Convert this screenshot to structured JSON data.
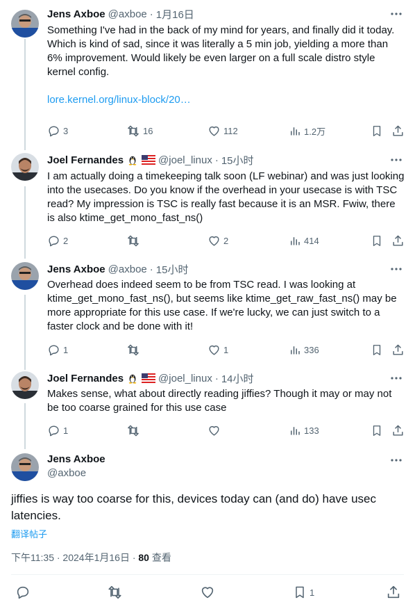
{
  "colors": {
    "accent": "#1d9bf0",
    "muted": "#536471",
    "text": "#0f1419",
    "thread_line": "#cfd9de"
  },
  "tweets": [
    {
      "name": "Jens Axboe",
      "handle": "@axboe",
      "time": "1月16日",
      "text": "Something I've had in the back of my mind for years, and finally did it today. Which is kind of sad, since it was literally a 5 min job, yielding a more than 6% improvement. Would likely be even larger on a full scale distro style kernel config.",
      "link": "lore.kernel.org/linux-block/20…",
      "replies": "3",
      "reposts": "16",
      "likes": "112",
      "views": "1.2万"
    },
    {
      "name": "Joel Fernandes",
      "handle": "@joel_linux",
      "time": "15小时",
      "emoji": [
        "penguin-icon",
        "us-flag-icon"
      ],
      "text": "I am actually doing a timekeeping talk soon (LF webinar) and was just looking into the usecases. Do you know if the overhead in your usecase is with TSC read? My impression is TSC is really fast because it is an MSR. Fwiw, there is also ktime_get_mono_fast_ns()",
      "replies": "2",
      "reposts": "",
      "likes": "2",
      "views": "414"
    },
    {
      "name": "Jens Axboe",
      "handle": "@axboe",
      "time": "15小时",
      "text": "Overhead does indeed seem to be from TSC read. I was looking at ktime_get_mono_fast_ns(), but seems like ktime_get_raw_fast_ns() may be more appropriate for this use case. If we're lucky, we can just switch to a faster clock and be done with it!",
      "replies": "1",
      "reposts": "",
      "likes": "1",
      "views": "336"
    },
    {
      "name": "Joel Fernandes",
      "handle": "@joel_linux",
      "time": "14小时",
      "emoji": [
        "penguin-icon",
        "us-flag-icon"
      ],
      "text": "Makes sense, what about directly reading jiffies? Though it may or may not be too coarse grained for this use case",
      "replies": "1",
      "reposts": "",
      "likes": "",
      "views": "133"
    }
  ],
  "main": {
    "name": "Jens Axboe",
    "handle": "@axboe",
    "text": "jiffies is way too coarse for this, devices today can (and do) have usec latencies.",
    "translate": "翻译帖子",
    "meta_time": "下午11:35 · 2024年1月16日 · ",
    "views_count": "80",
    "views_label": " 查看",
    "bookmarks": "1"
  }
}
